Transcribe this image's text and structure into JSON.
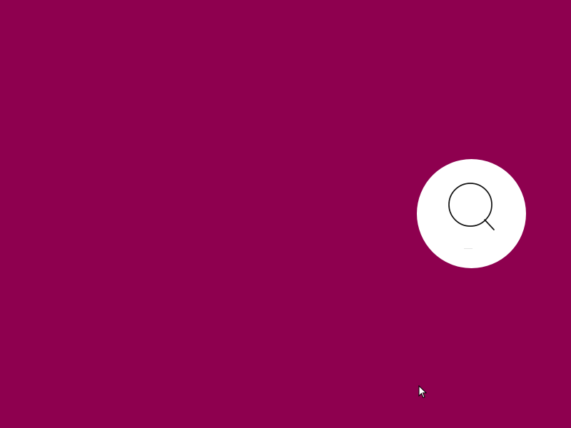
{
  "screen": {
    "background_color": "#8e004f"
  },
  "search_button": {
    "icon": "search-icon",
    "background_color": "#ffffff",
    "icon_color": "#111111"
  },
  "pointer": {
    "icon": "mouse-cursor-icon"
  }
}
